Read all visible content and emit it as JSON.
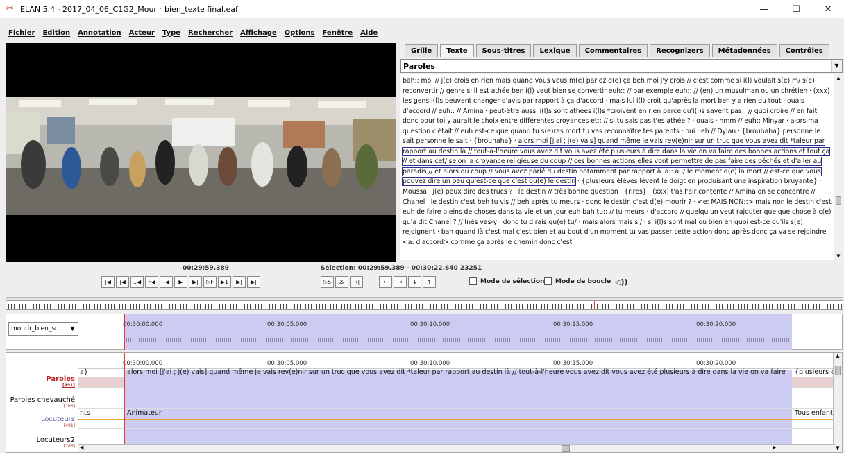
{
  "window": {
    "title": "ELAN 5.4 - 2017_04_06_C1G2_Mourir bien_texte final.eaf",
    "minimize": "—",
    "maximize": "☐",
    "close": "✕"
  },
  "menu": [
    "Fichier",
    "Edition",
    "Annotation",
    "Acteur",
    "Type",
    "Rechercher",
    "Affichage",
    "Options",
    "Fenêtre",
    "Aide"
  ],
  "tabs": [
    "Grille",
    "Texte",
    "Sous-titres",
    "Lexique",
    "Commentaires",
    "Recognizers",
    "Métadonnées",
    "Contrôles"
  ],
  "tier_select": "Paroles",
  "text": {
    "before": "bah:: moi // j(e) crois en rien mais quand vous vous m(e) parlez d(e) ça beh moi j'y crois // c'est comme si i(l) voulait s(e) m/ s(e) reconvertir // genre si il est athée ben i(l) veut bien se convertir euh:: // par exemple euh:: // (en) un musulman ou un chrétien · (xxx) les gens i(l)s peuvent changer d'avis par rapport à ça d'accord · mais lui i(l) croit qu'après la mort beh y a rien du tout · ouais d'accord // euh:: // Amina · peut-être aussi i(l)s sont athées i(l)s *croivent en rien parce qu'i(l)s savent pas:: // quoi croire // en fait · donc pour toi y aurait le choix entre différentes croyances et:: // si tu sais pas t'es athée ? · ouais · hmm // euh:: Minyar · alors ma question c'était // euh est-ce que quand tu s(e)ras mort tu vas reconnaître tes parents · oui · eh // Dylan · {brouhaha} personne le sait personne le sait · {brouhaha} · ",
    "highlight": "alors moi [j'ai ; j(e) vais] quand même je vais rev(e)nir sur un truc que vous avez dit *taleur par rapport au destin là // tout-à-l'heure vous avez dit vous avez été plusieurs à dire dans la vie on va faire des bonnes actions et tout ça // et dans cet/ selon la croyance religieuse du coup // ces bonnes actions elles vont permettre de pas faire des péchés et d'aller au paradis // et alors du coup // vous avez parlé du destin notamment par rapport à la:: au/ le moment d(e) la mort // est-ce que vous pouvez dire un peu qu'est-ce que c'est qu(e) le destin",
    "after": " · {plusieurs élèves lèvent le doigt en produisant une inspiration bruyante} · Moussa · j(e) peux dire des trucs ? · le destin // très bonne question · {rires} · (xxx) t'as l'air contente // Amina on se concentre // Chanel · le destin c'est beh tu vis // beh après tu meurs · donc le destin c'est d(e) mourir ? · <e: MAIS NON::> mais non le destin c'est euh de faire pleins de choses dans ta vie et un jour euh bah tu:: // tu meurs · d'accord // quelqu'un veut rajouter quelque chose à c(e) qu'a dit Chanel ? // Inès vas-y · donc tu dirais qu(e) tu/ · mais alors mais si/ · si i(l)s sont mal ou bien en quoi est-ce qu'ils s(e) rejoignent · bah quand là c'est mal c'est bien et au bout d'un moment tu vas passer cette action donc après donc ça va se rejoindre <a: d'accord> comme ça après le chemin donc c'est"
  },
  "player": {
    "time": "00:29:59.389",
    "selection": "Sélection: 00:29:59.389 - 00:30:22.640  23251"
  },
  "buttons": [
    "|◀",
    "|◀",
    "1◀",
    "F◀",
    "-◀",
    "▶",
    "▶|",
    "▷F",
    "▶1",
    "▶|",
    "▶|"
  ],
  "buttons2": [
    "▷S",
    "S̸",
    "→|"
  ],
  "buttons3": [
    "←",
    "→",
    "↓",
    "↑"
  ],
  "mode_selection": "Mode de sélection",
  "mode_boucle": "Mode de boucle",
  "volume_icon": "speaker-icon",
  "wave": {
    "combo": "mourir_bien_so...",
    "times": [
      "00:30:00.000",
      "00:30:05.000",
      "00:30:10.000",
      "00:30:15.000",
      "00:30:20.000"
    ]
  },
  "tiers": {
    "names": [
      {
        "name": "Paroles",
        "count": "[491]"
      },
      {
        "name": "Paroles chevauché",
        "count": "[166]"
      },
      {
        "name": "Locuteurs",
        "count": "[491]"
      },
      {
        "name": "Locuteurs2",
        "count": "[166]"
      }
    ],
    "times": [
      "00:30:00.000",
      "00:30:05.000",
      "00:30:10.000",
      "00:30:15.000",
      "00:30:20.000"
    ],
    "paroles_prev": "a}",
    "paroles_main": "alors moi [j'ai ; j(e) vais] quand même je vais rev(e)nir sur un truc que vous avez dit *taleur par rapport au destin là // tout-à-l'heure vous avez dit vous avez été plusieurs à dire dans la vie on va faire",
    "paroles_next": "{plusieurs é",
    "loc_prev": "nts",
    "loc_main": "Animateur",
    "loc_next": "Tous enfant"
  }
}
